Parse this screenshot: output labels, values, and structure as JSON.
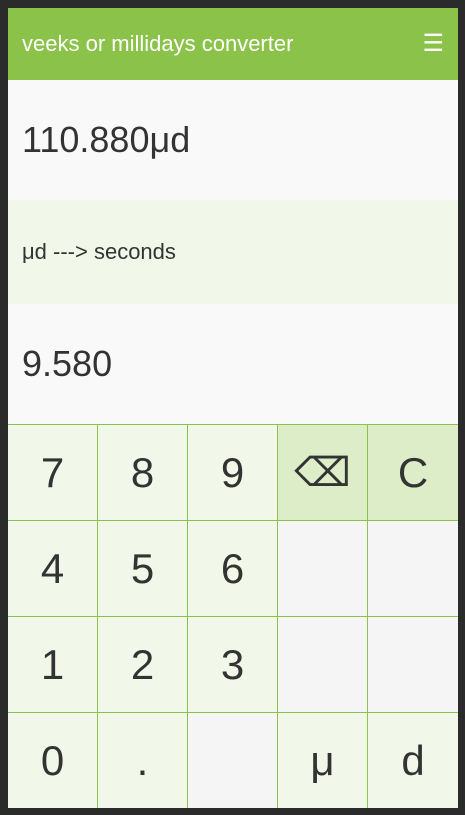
{
  "header": {
    "title": "veeks or millidays converter",
    "menu_icon": "☰"
  },
  "display": {
    "input": "110.880μd",
    "mode": "μd ---> seconds",
    "result": "9.580"
  },
  "keypad": {
    "k7": "7",
    "k8": "8",
    "k9": "9",
    "backspace": "⌫",
    "clear": "C",
    "k4": "4",
    "k5": "5",
    "k6": "6",
    "k1": "1",
    "k2": "2",
    "k3": "3",
    "k0": "0",
    "dot": ".",
    "micro": "μ",
    "day": "d"
  },
  "colors": {
    "accent": "#8bc34a",
    "key_bg": "#f1f8e9",
    "action_key_bg": "#dcedc8"
  }
}
